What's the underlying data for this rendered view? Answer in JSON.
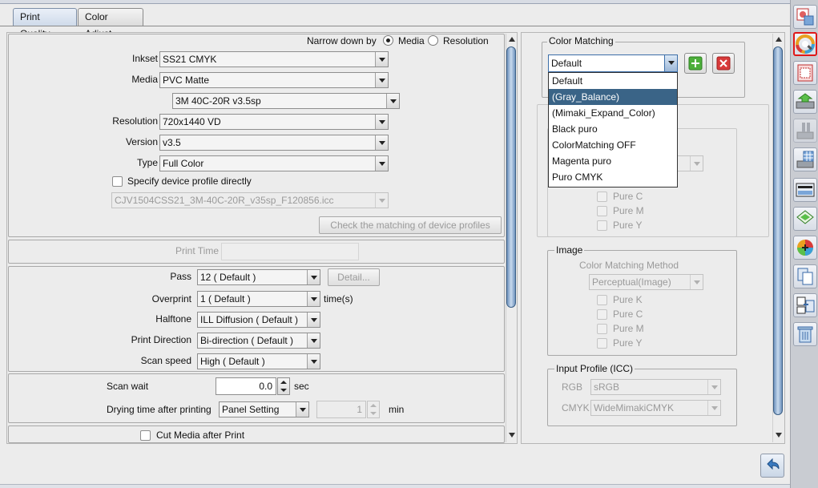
{
  "tabs": [
    {
      "label": "Print Quality",
      "active": true
    },
    {
      "label": "Color Adjust",
      "active": false
    }
  ],
  "left": {
    "narrow_label": "Narrow down by",
    "narrow_options": [
      "Media",
      "Resolution"
    ],
    "narrow_selected": "Media",
    "inkset": {
      "label": "Inkset",
      "value": "SS21 CMYK"
    },
    "media": {
      "label": "Media",
      "value": "PVC Matte"
    },
    "media_sub": {
      "value": "3M 40C-20R v3.5sp"
    },
    "resolution": {
      "label": "Resolution",
      "value": "720x1440 VD"
    },
    "version": {
      "label": "Version",
      "value": "v3.5"
    },
    "type": {
      "label": "Type",
      "value": "Full Color"
    },
    "specify_profile": {
      "label": "Specify device profile directly",
      "checked": false
    },
    "profile_file": {
      "value": "CJV1504CSS21_3M-40C-20R_v35sp_F120856.icc"
    },
    "check_button": "Check the matching of device profiles",
    "print_time": {
      "label": "Print Time",
      "value": ""
    },
    "pass": {
      "label": "Pass",
      "value": "12 ( Default )"
    },
    "detail_button": "Detail...",
    "overprint": {
      "label": "Overprint",
      "value": "1 ( Default )",
      "unit": "time(s)"
    },
    "halftone": {
      "label": "Halftone",
      "value": "ILL Diffusion ( Default )"
    },
    "print_direction": {
      "label": "Print Direction",
      "value": "Bi-direction ( Default )"
    },
    "scan_speed": {
      "label": "Scan speed",
      "value": "High ( Default )"
    },
    "scan_wait": {
      "label": "Scan wait",
      "value": "0.0",
      "unit": "sec"
    },
    "drying": {
      "label": "Drying time after printing",
      "mode": "Panel Setting",
      "value": "1",
      "unit": "min"
    },
    "cut_media": {
      "label": "Cut Media after Print",
      "checked": false
    }
  },
  "right": {
    "color_matching": {
      "legend": "Color Matching",
      "value": "Default",
      "options": [
        "Default",
        "(Gray_Balance)",
        "(Mimaki_Expand_Color)",
        "Black puro",
        "ColorMatching OFF",
        "Magenta puro",
        "Puro CMYK"
      ],
      "highlighted": "(Gray_Balance)"
    },
    "upper_group": {
      "pure_labels": [
        "Pure C",
        "Pure M",
        "Pure Y"
      ]
    },
    "image": {
      "legend": "Image",
      "method_label": "Color Matching Method",
      "method_value": "Perceptual(Image)",
      "pure_labels": [
        "Pure K",
        "Pure C",
        "Pure M",
        "Pure Y"
      ]
    },
    "input_profile": {
      "legend": "Input Profile (ICC)",
      "rgb_label": "RGB",
      "rgb_value": "sRGB",
      "cmyk_label": "CMYK",
      "cmyk_value": "WideMimakiCMYK"
    }
  },
  "toolbar_icons": [
    "print-quality-icon",
    "color-matching-icon",
    "layout-icon",
    "printer-home-icon",
    "printer-queue-icon",
    "printer-pattern-icon",
    "media-icon",
    "layers-icon",
    "color-wheel-icon",
    "copy-icon",
    "swap-icon",
    "trash-icon"
  ],
  "colors": {
    "selection": "#3a6487",
    "scroll_thumb": "#6f93bd",
    "delete_button": "#d83a3a",
    "add_button": "#4caf3a",
    "selected_tool_border": "#e01818"
  }
}
